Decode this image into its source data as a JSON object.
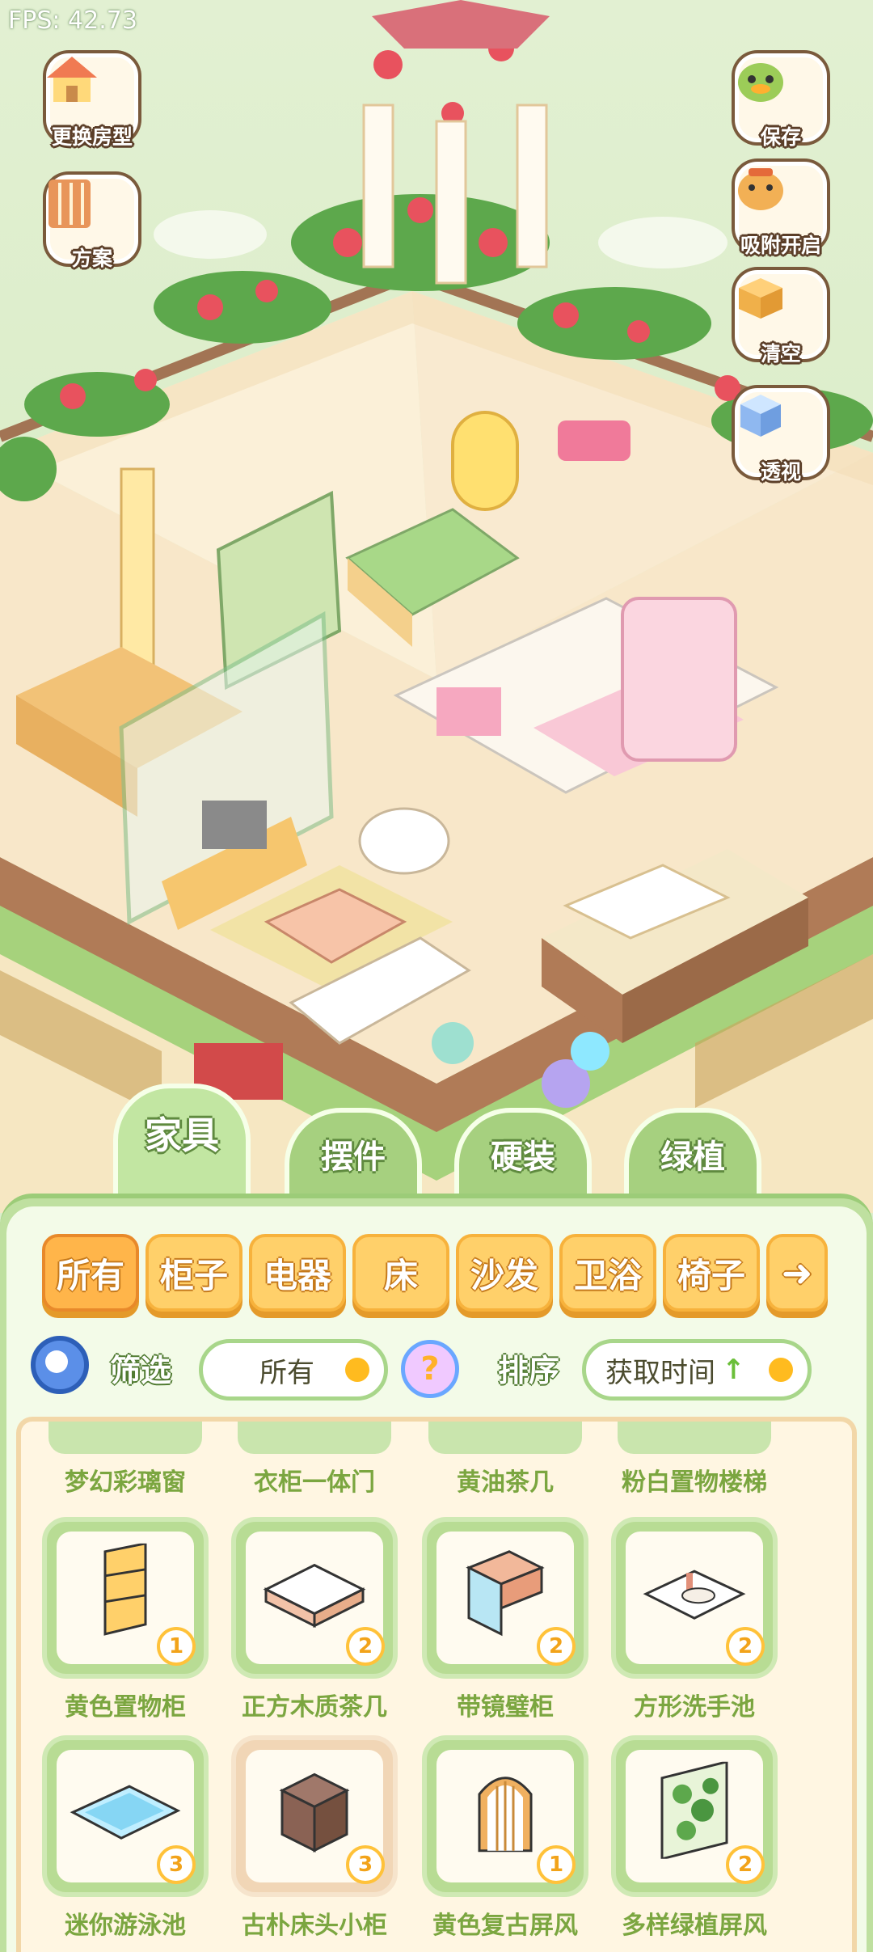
{
  "hud": {
    "fps": "FPS: 42.73"
  },
  "side_buttons": {
    "change_room": "更换房型",
    "plan": "方案",
    "save": "保存",
    "snap": "吸附开启",
    "clear": "清空",
    "perspective": "透视"
  },
  "category_tabs": [
    {
      "label": "家具",
      "active": true
    },
    {
      "label": "摆件",
      "active": false
    },
    {
      "label": "硬装",
      "active": false
    },
    {
      "label": "绿植",
      "active": false
    }
  ],
  "sub_tabs": [
    {
      "label": "所有",
      "active": true
    },
    {
      "label": "柜子"
    },
    {
      "label": "电器"
    },
    {
      "label": "床"
    },
    {
      "label": "沙发"
    },
    {
      "label": "卫浴"
    },
    {
      "label": "椅子"
    }
  ],
  "filter": {
    "label": "筛选",
    "value": "所有"
  },
  "sort": {
    "label": "排序",
    "value": "获取时间",
    "direction": "↑"
  },
  "items_cut": [
    {
      "name": "梦幻彩璃窗"
    },
    {
      "name": "衣柜一体门"
    },
    {
      "name": "黄油茶几"
    },
    {
      "name": "粉白置物楼梯"
    }
  ],
  "items": [
    {
      "name": "黄色置物柜",
      "count": "1"
    },
    {
      "name": "正方木质茶几",
      "count": "2"
    },
    {
      "name": "带镜璧柜",
      "count": "2"
    },
    {
      "name": "方形洗手池",
      "count": "2"
    },
    {
      "name": "迷你游泳池",
      "count": "3"
    },
    {
      "name": "古朴床头小柜",
      "count": "3",
      "selected": true
    },
    {
      "name": "黄色复古屏风",
      "count": "1"
    },
    {
      "name": "多样绿植屏风",
      "count": "2"
    }
  ],
  "colors": {
    "panel_green": "#bfe0a0",
    "tab_orange": "#ffd06a",
    "text_green": "#7ba640",
    "badge_orange": "#f2a31a"
  }
}
